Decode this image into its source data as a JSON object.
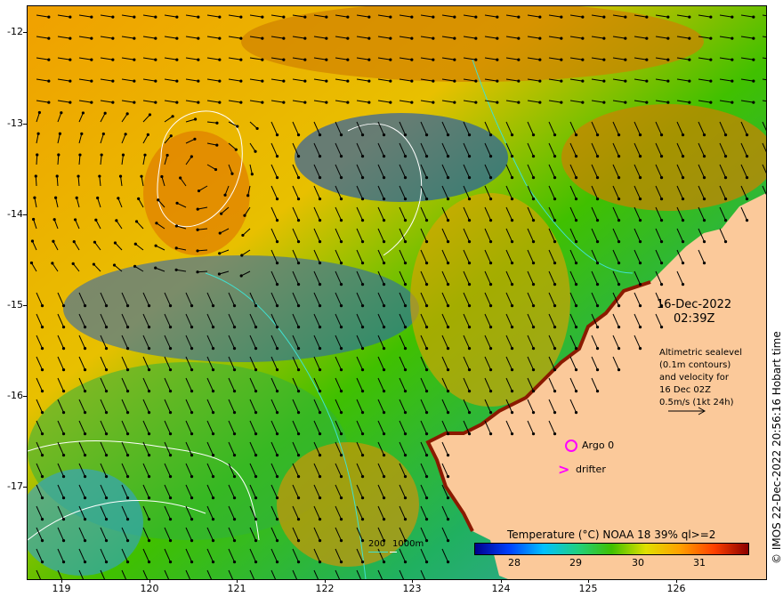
{
  "map": {
    "y_ticks": [
      "-12",
      "-13",
      "-14",
      "-15",
      "-16",
      "-17"
    ],
    "x_ticks": [
      "119",
      "120",
      "121",
      "122",
      "123",
      "124",
      "125",
      "126"
    ],
    "lon_range": [
      118.6,
      127.0
    ],
    "lat_range": [
      -17.95,
      -11.65
    ]
  },
  "annotation": {
    "date": "16-Dec-2022",
    "time": "02:39Z",
    "legend_lines": [
      "Altimetric sealevel",
      "(0.1m contours)",
      "and velocity for",
      "16 Dec 02Z",
      "0.5m/s (1kt 24h)"
    ]
  },
  "markers": {
    "argo_label": "Argo 0",
    "drifter_label": "drifter",
    "argo_color": "#ff00ff",
    "drifter_glyph": ">"
  },
  "contour_key": {
    "depth_200": "200",
    "depth_1000": "1000m",
    "color_200": "#40e0d0",
    "color_1000": "#ffffff"
  },
  "colorbar": {
    "title": "Temperature (°C) NOAA 18 39% ql>=2",
    "ticks": [
      "28",
      "29",
      "30",
      "31"
    ],
    "range": [
      27.2,
      31.8
    ]
  },
  "credit": "© IMOS 22-Dec-2022 20:56:16 Hobart time",
  "colors": {
    "land": "#fbc99a",
    "cold": "#00008b",
    "warm": "#8b0000",
    "arrow": "#000000"
  }
}
